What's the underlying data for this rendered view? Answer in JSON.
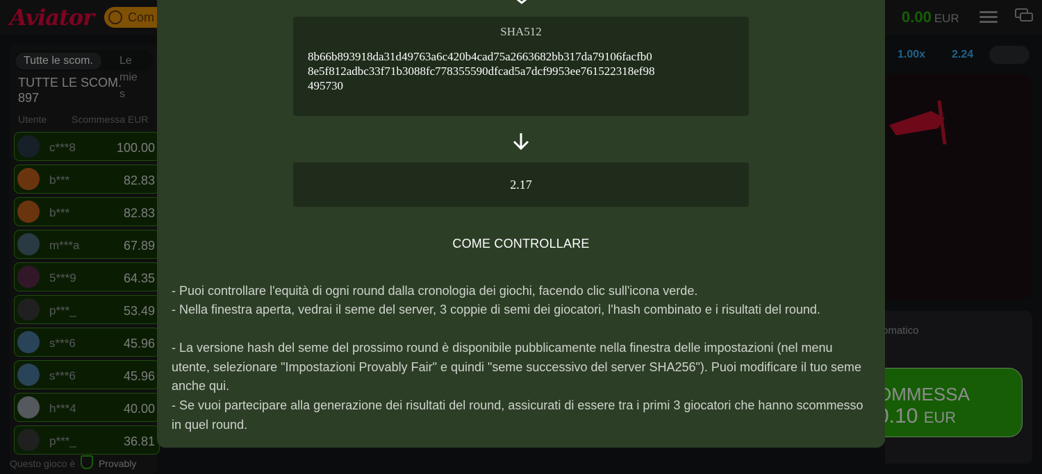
{
  "header": {
    "logo": "Aviator",
    "howto_label": "Com",
    "balance": "0.00",
    "currency": "EUR",
    "icons": [
      "menu-icon",
      "chat-icon",
      "coin-icon"
    ]
  },
  "left_panel": {
    "tabs": [
      "Tutte le scom.",
      "Le mie s"
    ],
    "all_bets_title": "TUTTE LE SCOM.",
    "all_bets_count": "897",
    "col_user": "Utente",
    "col_bet": "Scommessa EUR",
    "rows": [
      {
        "user": "c***8",
        "amount": "100.00"
      },
      {
        "user": "b***",
        "amount": "82.83"
      },
      {
        "user": "b***",
        "amount": "82.83"
      },
      {
        "user": "m***a",
        "amount": "67.89"
      },
      {
        "user": "5***9",
        "amount": "64.35"
      },
      {
        "user": "p***_",
        "amount": "53.49"
      },
      {
        "user": "s***6",
        "amount": "45.96"
      },
      {
        "user": "s***6",
        "amount": "45.96"
      },
      {
        "user": "h***4",
        "amount": "40.00"
      },
      {
        "user": "p***_",
        "amount": "36.81"
      }
    ],
    "footer_prefix": "Questo gioco è",
    "footer_brand": "Provably"
  },
  "right_panel": {
    "history": [
      "1.00x",
      "2.24"
    ],
    "auto_tab": "omatico",
    "bet_button_line1": "OMMESSA",
    "bet_button_amount": "0.10",
    "bet_button_currency": "EUR"
  },
  "modal": {
    "sha_title": "SHA512",
    "hash_lines": [
      "8b66b893918da31d49763a6c420b4cad75a2663682bb317da79106facfb0",
      "8e5f812adbc33f71b3088fc778355590dfcad5a7dcf9953ee761522318ef98",
      "495730"
    ],
    "result": "2.17",
    "how_title": "COME CONTROLLARE",
    "paragraphs": [
      "- Puoi controllare l'equità di ogni round dalla cronologia dei giochi, facendo clic sull'icona verde.",
      "- Nella finestra aperta, vedrai il seme del server, 3 coppie di semi dei giocatori, l'hash combinato e i risultati del round.",
      "- La versione hash del seme del prossimo round è disponibile pubblicamente nella finestra delle impostazioni (nel menu utente, selezionare \"Impostazioni Provably Fair\" e quindi \"seme successivo del server SHA256\"). Puoi modificare il tuo seme anche qui.",
      "- Se vuoi partecipare alla generazione dei risultati del round, assicurati di essere tra i primi 3 giocatori che hanno scommesso in quel round."
    ]
  },
  "colors": {
    "modal_bg": "#2c3e26",
    "box_bg": "#1f2c1b",
    "brand_red": "#e50539",
    "win_green": "#28a909"
  }
}
